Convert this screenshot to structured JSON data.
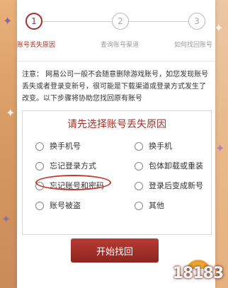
{
  "steps": [
    {
      "number": "1",
      "label": "账号丢失原因",
      "active": true
    },
    {
      "number": "2",
      "label": "查询账号渠道",
      "active": false
    },
    {
      "number": "3",
      "label": "如何找回账号",
      "active": false
    }
  ],
  "notice": "注意：  网易公司一般不会随意删除游戏账号，如您发现账号丢失或者登录变新号，很可能是下载渠道或登录方式发生了改变。以下步骤将协助您找回原有账号",
  "panel": {
    "title": "请先选择账号丢失原因",
    "options": [
      "换手机号",
      "换手机",
      "忘记登录方式",
      "包体卸载或重装",
      "忘记账号和密码",
      "登录后变成新号",
      "账号被盗",
      "其他"
    ]
  },
  "submit_label": "开始找回",
  "watermark": "18183",
  "colors": {
    "accent": "#a0302b",
    "highlight_ring": "#c0392b"
  }
}
